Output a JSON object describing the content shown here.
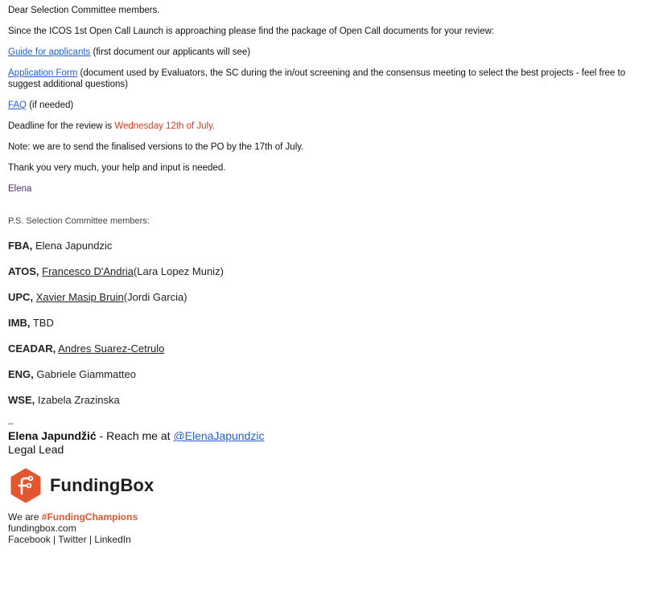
{
  "email": {
    "greeting": "Dear Selection Committee members.",
    "intro": "Since the ICOS 1st Open Call Launch is approaching please find the package of Open Call documents for your review:",
    "docs": [
      {
        "link": "Guide for applicants",
        "note": " (first document our applicants will see)"
      },
      {
        "link": "Application Form",
        "note": " (document used by Evaluators, the SC during the in/out screening and the consensus meeting to select the best projects - feel free to suggest additional questions)"
      },
      {
        "link": "FAQ",
        "note": " (if needed)"
      }
    ],
    "deadline_prefix": "Deadline for the review is ",
    "deadline_date": "Wednesday 12th of July.",
    "note": "Note: we are to send the finalised versions to the PO by the 17th of July.",
    "thanks": "Thank you very much, your help and input is needed.",
    "signoff": "Elena",
    "ps": "P.S. Selection Committee members:",
    "members": [
      {
        "org": "FBA,",
        "name": " Elena Japundzic",
        "link": "",
        "extra": ""
      },
      {
        "org": "ATOS,",
        "name": " ",
        "link": "Francesco D'Andria",
        "extra": "(Lara Lopez Muniz)"
      },
      {
        "org": "UPC,",
        "name": " ",
        "link": "Xavier Masip Bruin",
        "extra": "(Jordi Garcia)"
      },
      {
        "org": "IMB,",
        "name": " TBD",
        "link": "",
        "extra": ""
      },
      {
        "org": "CEADAR,",
        "name": " ",
        "link": "Andres Suarez-Cetrulo",
        "extra": ""
      },
      {
        "org": "ENG,",
        "name": " Gabriele Giammatteo",
        "link": "",
        "extra": ""
      },
      {
        "org": "WSE,",
        "name": " Izabela Zrazinska",
        "link": "",
        "extra": ""
      }
    ]
  },
  "signature": {
    "dashes": "--",
    "name": "Elena Japundžić",
    "reach": " - Reach me at ",
    "handle": "@ElenaJapundzic",
    "role": "Legal Lead",
    "brand": "FundingBox",
    "we_are": "We are ",
    "hashtag": "#FundingChampions",
    "site": "fundingbox.com",
    "social": "Facebook | Twitter | LinkedIn"
  },
  "colors": {
    "link": "#1f5fd6",
    "deadline": "#e03b1b",
    "signoff": "#5a2a7a",
    "brand": "#e4572e"
  }
}
